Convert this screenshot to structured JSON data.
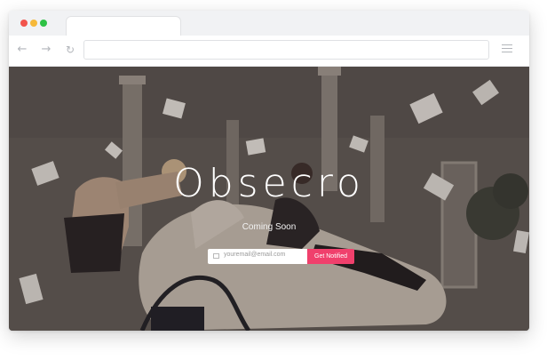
{
  "hero": {
    "logo_text": "Obsecro",
    "tagline": "Coming Soon"
  },
  "signup": {
    "email_placeholder": "youremail@email.com",
    "button_label": "Get Notified"
  },
  "colors": {
    "button": "#f0406c",
    "close_dot": "#f2544c",
    "minimize_dot": "#f6b93a",
    "maximize_dot": "#2ec245"
  }
}
